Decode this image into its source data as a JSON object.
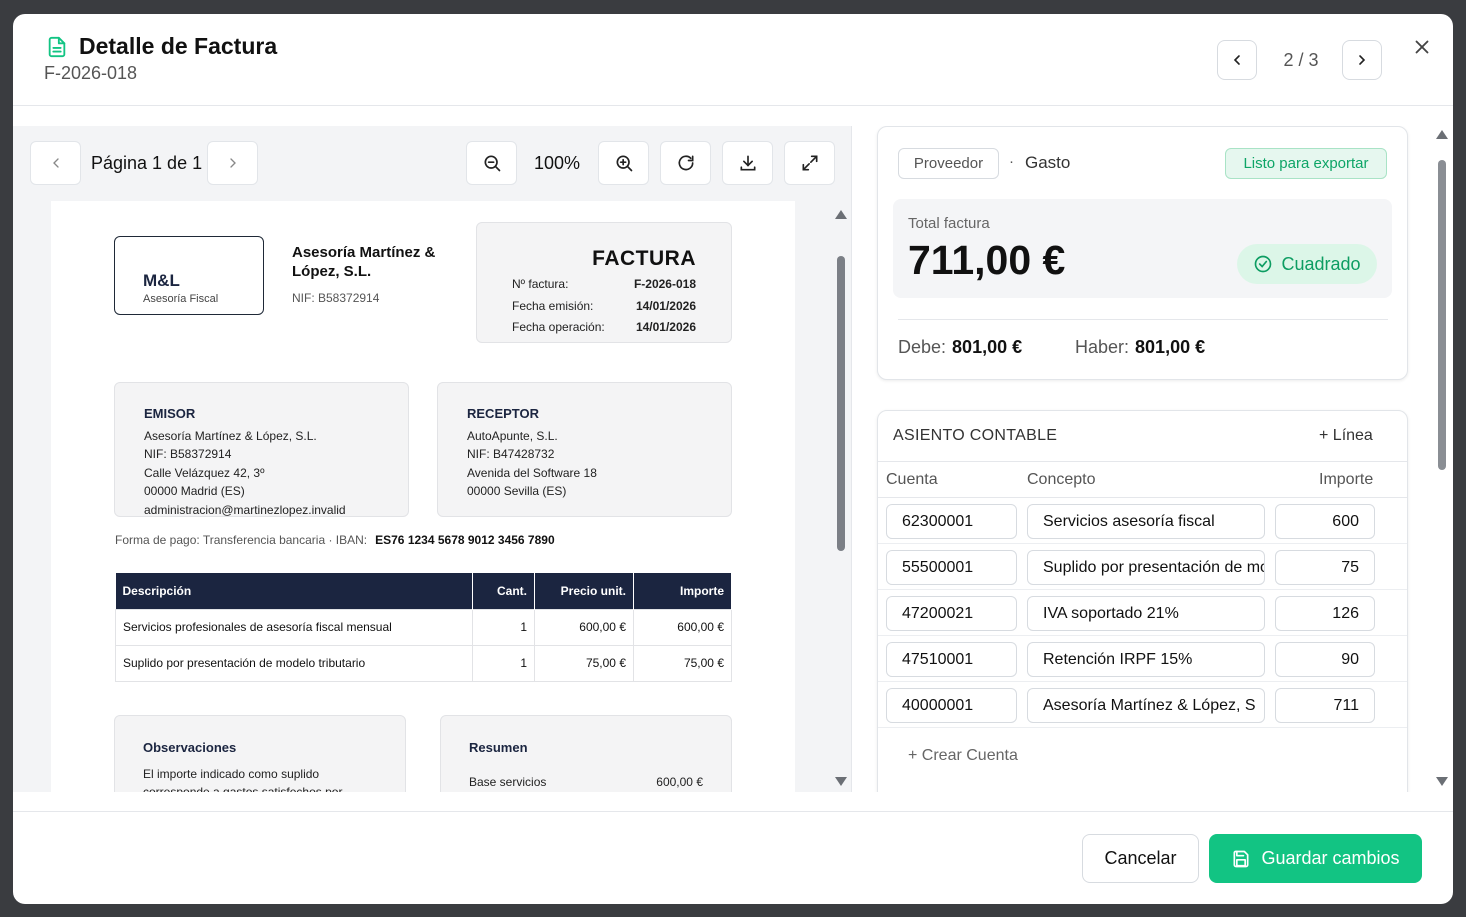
{
  "header": {
    "title": "Detalle de Factura",
    "subtitle": "F-2026-018",
    "pager": "2 / 3"
  },
  "viewer": {
    "page_label": "Página 1 de 1",
    "zoom": "100%",
    "invoice": {
      "logo_main": "M&L",
      "logo_sub": "Asesoría Fiscal",
      "company": "Asesoría Martínez & López, S.L.",
      "company_nif": "NIF: B58372914",
      "doc_title": "FACTURA",
      "meta": [
        {
          "label": "Nº factura:",
          "value": "F-2026-018"
        },
        {
          "label": "Fecha emisión:",
          "value": "14/01/2026"
        },
        {
          "label": "Fecha operación:",
          "value": "14/01/2026"
        }
      ],
      "emisor": {
        "heading": "EMISOR",
        "lines": [
          "Asesoría Martínez & López, S.L.",
          "NIF: B58372914",
          "Calle Velázquez 42, 3º",
          "00000 Madrid (ES)",
          "administracion@martinezlopez.invalid"
        ]
      },
      "receptor": {
        "heading": "RECEPTOR",
        "lines": [
          "AutoApunte, S.L.",
          "NIF: B47428732",
          "Avenida del Software 18",
          "00000 Sevilla (ES)"
        ]
      },
      "payment": {
        "text": "Forma de pago: Transferencia bancaria  ·  IBAN:",
        "iban": "ES76 1234 5678 9012 3456 7890"
      },
      "table": {
        "headers": [
          "Descripción",
          "Cant.",
          "Precio unit.",
          "Importe"
        ],
        "rows": [
          [
            "Servicios profesionales de asesoría fiscal mensual",
            "1",
            "600,00 €",
            "600,00 €"
          ],
          [
            "Suplido por presentación de modelo tributario",
            "1",
            "75,00 €",
            "75,00 €"
          ]
        ]
      },
      "observaciones": {
        "heading": "Observaciones",
        "text": "El importe indicado como suplido corresponde a gastos satisfechos por cuenta"
      },
      "resumen": {
        "heading": "Resumen",
        "label": "Base servicios",
        "value": "600,00 €"
      }
    }
  },
  "summary": {
    "chip": "Proveedor",
    "dot": "·",
    "type": "Gasto",
    "status": "Listo para exportar",
    "total_label": "Total factura",
    "total_value": "711,00 €",
    "balance_badge": "Cuadrado",
    "debe_label": "Debe:",
    "debe_value": "801,00 €",
    "haber_label": "Haber:",
    "haber_value": "801,00 €"
  },
  "asiento": {
    "heading": "ASIENTO CONTABLE",
    "add_line": "+ Línea",
    "columns": [
      "Cuenta",
      "Concepto",
      "Importe"
    ],
    "rows": [
      {
        "cuenta": "62300001",
        "concepto": "Servicios asesoría fiscal",
        "importe": "600"
      },
      {
        "cuenta": "55500001",
        "concepto": "Suplido por presentación de mo",
        "importe": "75"
      },
      {
        "cuenta": "47200021",
        "concepto": "IVA soportado 21%",
        "importe": "126"
      },
      {
        "cuenta": "47510001",
        "concepto": "Retención IRPF 15%",
        "importe": "90"
      },
      {
        "cuenta": "40000001",
        "concepto": "Asesoría Martínez & López, S",
        "importe": "711"
      }
    ],
    "create_account": "+ Crear Cuenta"
  },
  "footer": {
    "cancel": "Cancelar",
    "save": "Guardar cambios"
  },
  "colors": {
    "accent": "#12c483",
    "navy": "#1b2540",
    "success_bg": "#dcf6e8"
  }
}
